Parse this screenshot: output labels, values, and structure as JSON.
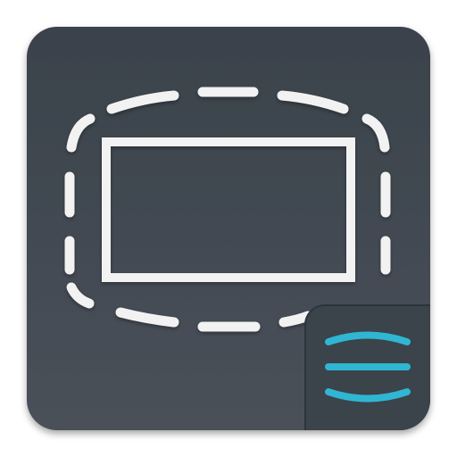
{
  "icon": {
    "semantic": "screen-resize-app-icon",
    "colors": {
      "tile_top": "#3a424b",
      "tile_bottom": "#4a5159",
      "frame": "#f2f2f2",
      "dashes": "#f2f2f2",
      "badge_bg": "#3b434b",
      "badge_accent": "#2fb6d2"
    }
  }
}
